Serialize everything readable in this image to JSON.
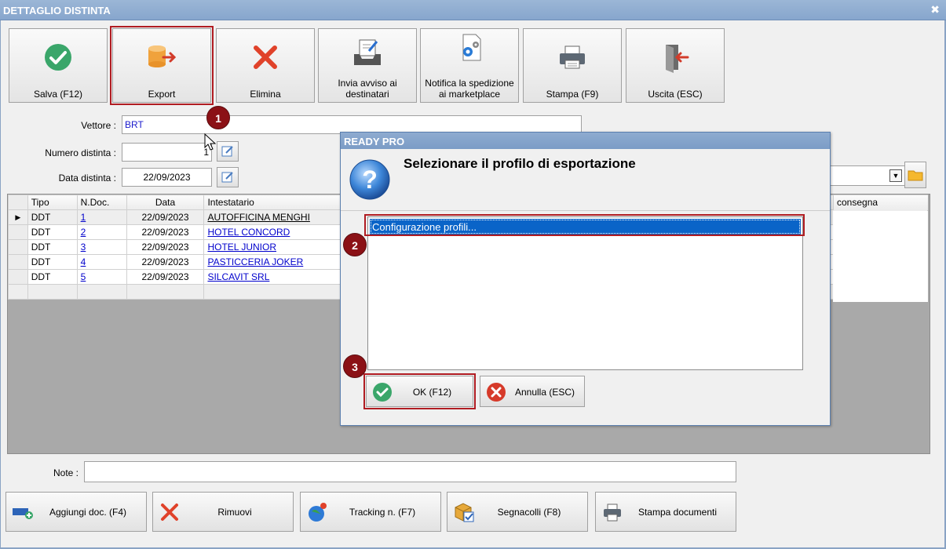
{
  "window": {
    "title": "DETTAGLIO DISTINTA",
    "close_glyph": "✖"
  },
  "toolbar": {
    "buttons": [
      {
        "label": "Salva (F12)",
        "icon": "check-circle-icon"
      },
      {
        "label": "Export",
        "icon": "export-database-icon"
      },
      {
        "label": "Elimina",
        "icon": "red-x-icon"
      },
      {
        "label": "Invia avviso ai destinatari",
        "icon": "inbox-edit-icon"
      },
      {
        "label": "Notifica la spedizione ai marketplace",
        "icon": "document-gear-icon"
      },
      {
        "label": "Stampa (F9)",
        "icon": "printer-icon"
      },
      {
        "label": "Uscita (ESC)",
        "icon": "exit-door-icon"
      }
    ]
  },
  "form": {
    "vettore_label": "Vettore :",
    "vettore_value": "BRT",
    "numero_label": "Numero distinta :",
    "numero_value": "1",
    "data_label": "Data distinta :",
    "data_value": "22/09/2023"
  },
  "grid": {
    "columns": [
      "Tipo",
      "N.Doc.",
      "Data",
      "Intestatario",
      "consegna"
    ],
    "rows": [
      {
        "tipo": "DDT",
        "ndoc": "1",
        "data": "22/09/2023",
        "intestatario": "AUTOFFICINA MENGHI",
        "current": true
      },
      {
        "tipo": "DDT",
        "ndoc": "2",
        "data": "22/09/2023",
        "intestatario": "HOTEL CONCORD"
      },
      {
        "tipo": "DDT",
        "ndoc": "3",
        "data": "22/09/2023",
        "intestatario": "HOTEL JUNIOR"
      },
      {
        "tipo": "DDT",
        "ndoc": "4",
        "data": "22/09/2023",
        "intestatario": "PASTICCERIA JOKER"
      },
      {
        "tipo": "DDT",
        "ndoc": "5",
        "data": "22/09/2023",
        "intestatario": "SILCAVIT SRL"
      }
    ]
  },
  "notes": {
    "label": "Note :",
    "value": ""
  },
  "bottom_buttons": [
    {
      "label": "Aggiungi doc. (F4)"
    },
    {
      "label": "Rimuovi"
    },
    {
      "label": "Tracking n. (F7)"
    },
    {
      "label": "Segnacolli (F8)"
    },
    {
      "label": "Stampa documenti"
    }
  ],
  "dialog": {
    "title": "READY PRO",
    "message": "Selezionare il profilo di esportazione",
    "list_items": [
      "Configurazione profili..."
    ],
    "ok_label": "OK (F12)",
    "cancel_label": "Annulla (ESC)"
  },
  "markers": [
    "1",
    "2",
    "3"
  ],
  "colors": {
    "accent_highlight": "#b01c22",
    "marker": "#8b1116",
    "selection": "#0a64c8",
    "link": "#0000cc"
  }
}
